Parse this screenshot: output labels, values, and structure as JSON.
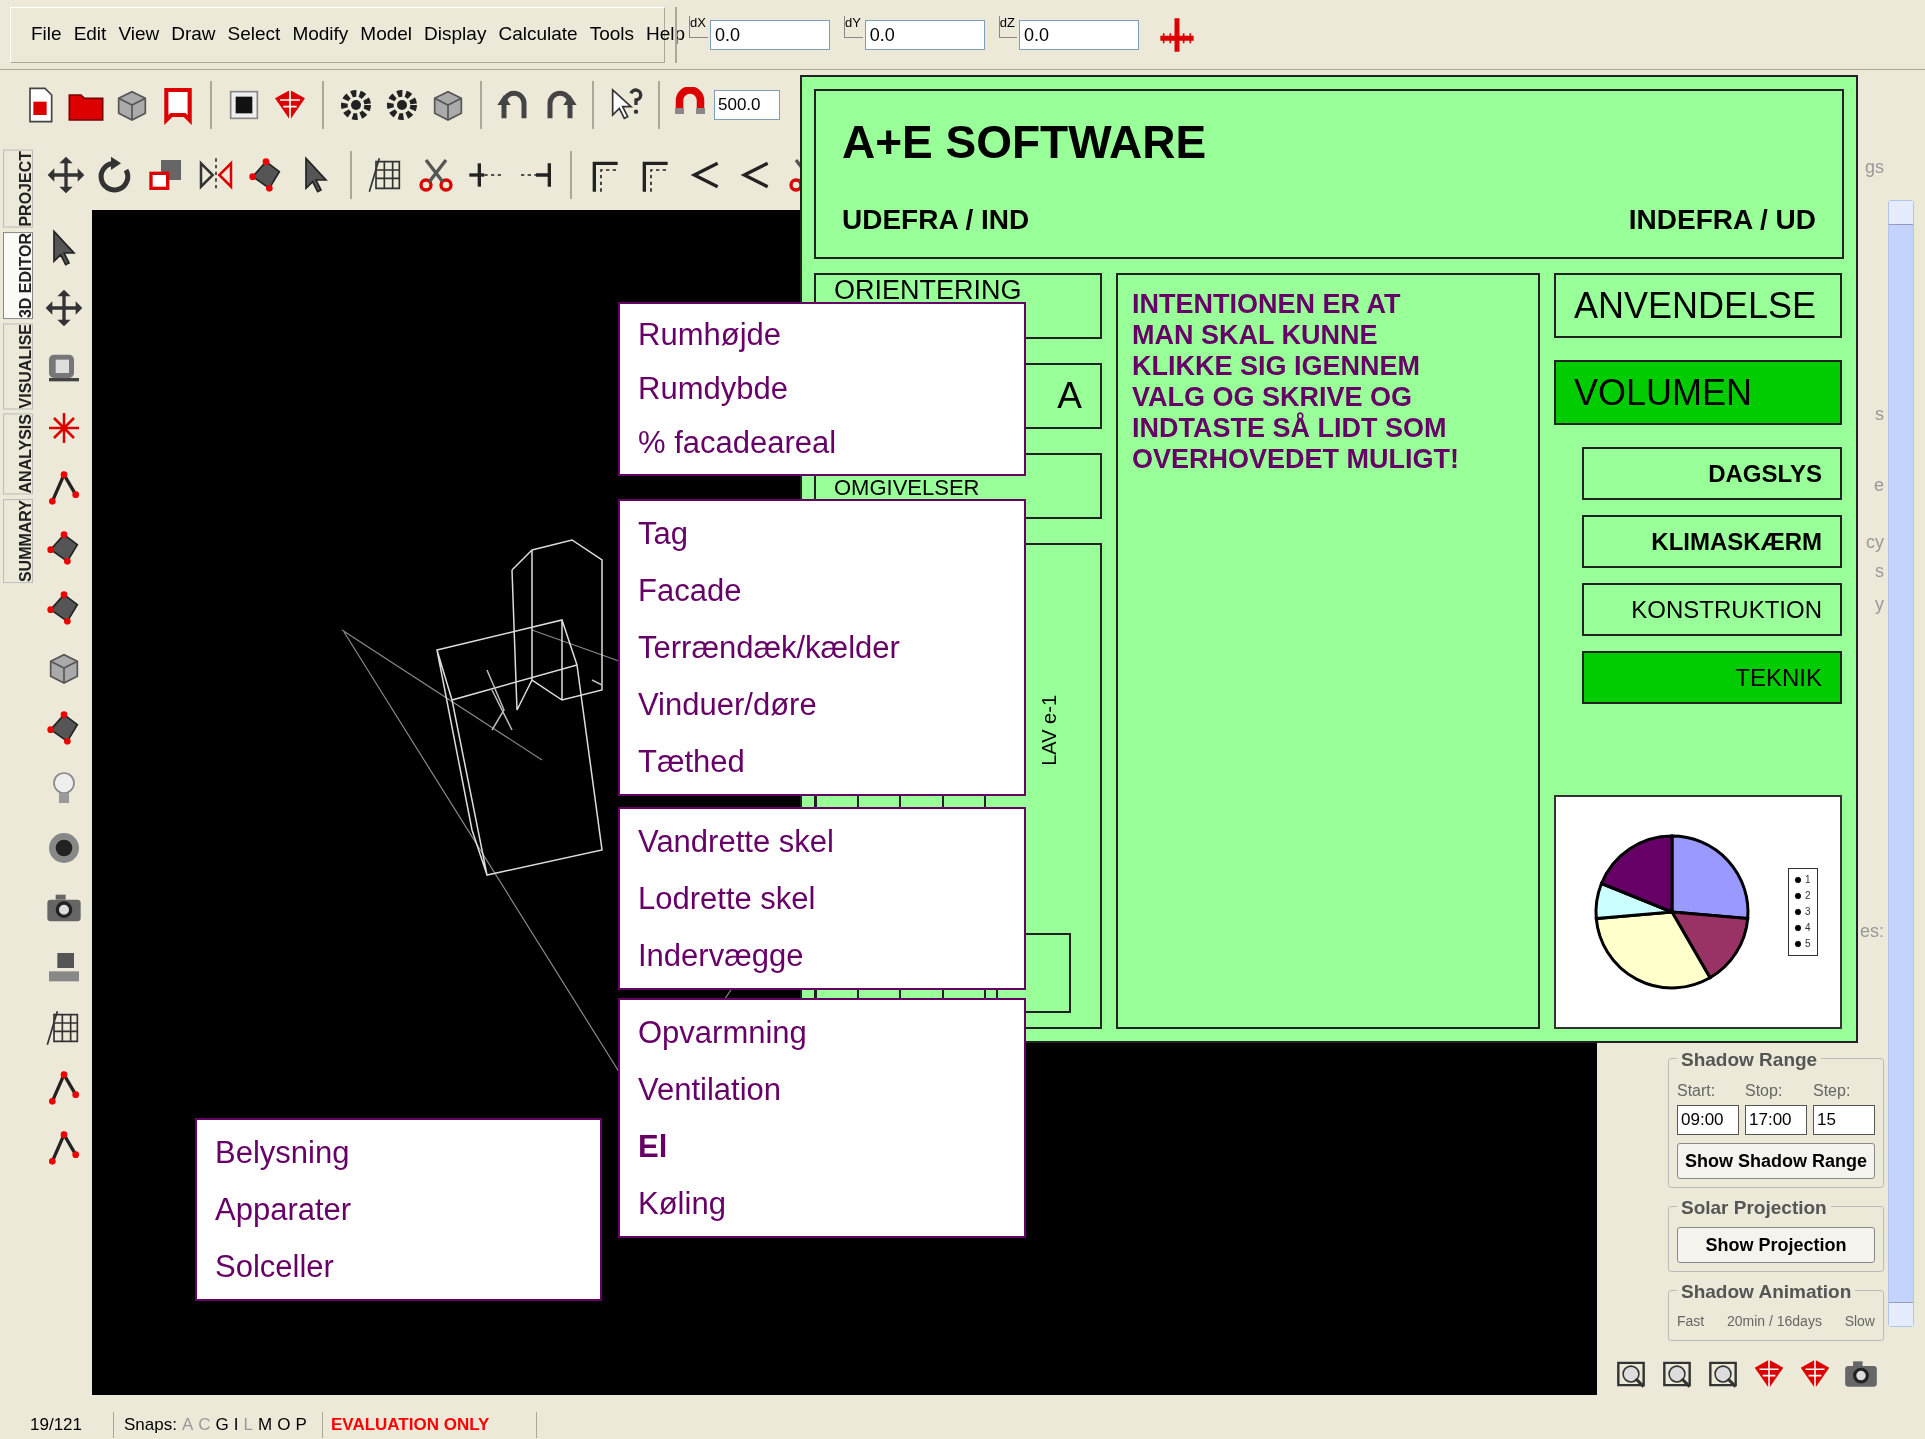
{
  "menu_bar": [
    "File",
    "Edit",
    "View",
    "Draw",
    "Select",
    "Modify",
    "Model",
    "Display",
    "Calculate",
    "Tools",
    "Help"
  ],
  "coordinate_fields": [
    {
      "label": "dX",
      "value": "0.0"
    },
    {
      "label": "dY",
      "value": "0.0"
    },
    {
      "label": "dZ",
      "value": "0.0"
    }
  ],
  "toolbar_field": {
    "value": "500.0"
  },
  "side_tabs": [
    {
      "label": "PROJECT",
      "selected": false
    },
    {
      "label": "3D EDITOR",
      "selected": true
    },
    {
      "label": "VISUALISE",
      "selected": false
    },
    {
      "label": "ANALYSIS",
      "selected": false
    },
    {
      "label": "SUMMARY",
      "selected": false
    }
  ],
  "overlay": {
    "title": "A+E SOFTWARE",
    "left_heading": "UDEFRA / IND",
    "right_heading": "INDEFRA / UD",
    "left_column": [
      {
        "label": "ORIENTERING"
      },
      {
        "label": "A"
      },
      {
        "label": "OMGIVELSER"
      }
    ],
    "vertical_label": "LAV e-1",
    "message": "INTENTIONEN ER AT\nMAN SKAL KUNNE\nKLIKKE SIG IGENNEM\nVALG OG SKRIVE OG\nINDTASTE SÅ LIDT SOM\nOVERHOVEDET MULIGT!",
    "main_buttons": [
      {
        "label": "ANVENDELSE",
        "selected": false
      },
      {
        "label": "VOLUMEN",
        "selected": true
      }
    ],
    "sub_buttons": [
      {
        "label": "DAGSLYS",
        "bold": true,
        "selected": false
      },
      {
        "label": "KLIMASKÆRM",
        "bold": true,
        "selected": false
      },
      {
        "label": "KONSTRUKTION",
        "bold": false,
        "selected": false
      },
      {
        "label": "TEKNIK",
        "bold": false,
        "selected": true
      }
    ],
    "chart_legend": [
      "1",
      "2",
      "3",
      "4",
      "5"
    ]
  },
  "popup_menus": [
    {
      "items": [
        {
          "label": "Rumhøjde",
          "bold": false
        },
        {
          "label": "Rumdybde",
          "bold": false
        },
        {
          "label": "% facadeareal",
          "bold": false
        }
      ]
    },
    {
      "items": [
        {
          "label": "Tag",
          "bold": false
        },
        {
          "label": "Facade",
          "bold": false
        },
        {
          "label": "Terrændæk/kælder",
          "bold": false
        },
        {
          "label": "Vinduer/døre",
          "bold": false
        },
        {
          "label": "Tæthed",
          "bold": false
        }
      ]
    },
    {
      "items": [
        {
          "label": "Vandrette skel",
          "bold": false
        },
        {
          "label": "Lodrette skel",
          "bold": false
        },
        {
          "label": "Indervægge",
          "bold": false
        }
      ]
    },
    {
      "items": [
        {
          "label": "Opvarmning",
          "bold": false
        },
        {
          "label": "Ventilation",
          "bold": false
        },
        {
          "label": "El",
          "bold": true
        },
        {
          "label": "Køling",
          "bold": false
        }
      ]
    },
    {
      "items": [
        {
          "label": "Belysning",
          "bold": false
        },
        {
          "label": "Apparater",
          "bold": false
        },
        {
          "label": "Solceller",
          "bold": false
        }
      ]
    }
  ],
  "right_panel": {
    "fragments": [
      "gs",
      "s",
      "e",
      "cy",
      "s",
      "y",
      "es:"
    ],
    "shadow_range": {
      "title": "Shadow Range",
      "labels": [
        "Start:",
        "Stop:",
        "Step:"
      ],
      "values": [
        "09:00",
        "17:00",
        "15"
      ],
      "button": "Show Shadow Range"
    },
    "solar_projection": {
      "title": "Solar Projection",
      "button": "Show Projection"
    },
    "shadow_animation": {
      "title": "Shadow Animation",
      "labels": [
        "Fast",
        "20min / 16days",
        "Slow"
      ]
    }
  },
  "status_bar": {
    "position": "19/121",
    "snaps_label": "Snaps:",
    "snaps": [
      {
        "letter": "A",
        "on": false
      },
      {
        "letter": "C",
        "on": false
      },
      {
        "letter": "G",
        "on": true
      },
      {
        "letter": "I",
        "on": true
      },
      {
        "letter": "L",
        "on": false
      },
      {
        "letter": "M",
        "on": true
      },
      {
        "letter": "O",
        "on": true
      },
      {
        "letter": "P",
        "on": true
      }
    ],
    "notice": "EVALUATION ONLY"
  }
}
